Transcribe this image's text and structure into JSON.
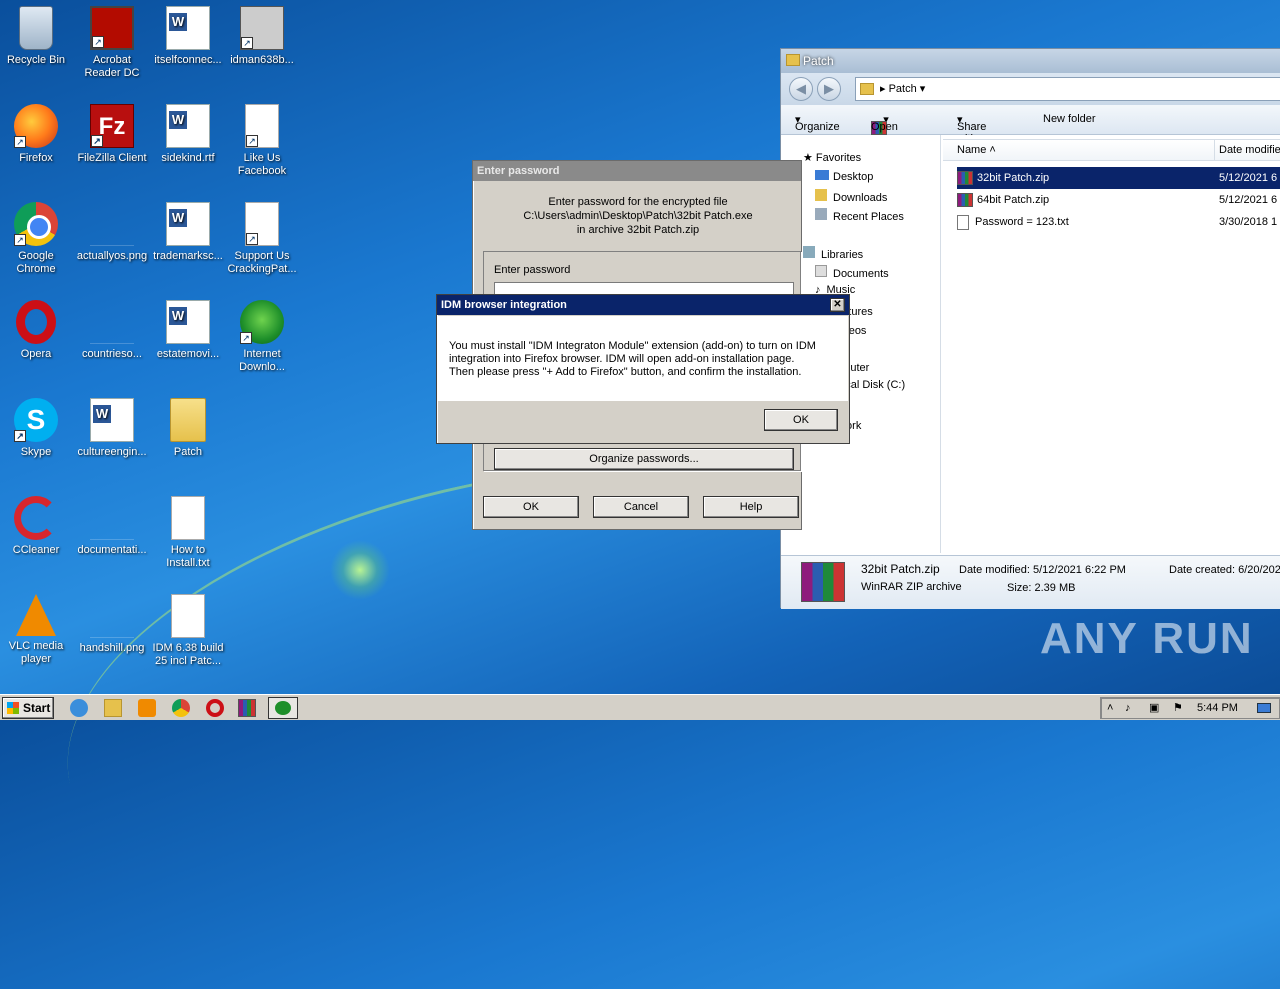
{
  "desktop": {
    "icons": [
      {
        "label": "Recycle Bin"
      },
      {
        "label": "Acrobat Reader DC"
      },
      {
        "label": "itselfconnec..."
      },
      {
        "label": "idman638b..."
      },
      {
        "label": "Firefox"
      },
      {
        "label": "FileZilla Client"
      },
      {
        "label": "sidekind.rtf"
      },
      {
        "label": "Like Us Facebook"
      },
      {
        "label": "Google Chrome"
      },
      {
        "label": "actuallyos.png"
      },
      {
        "label": "trademarksc..."
      },
      {
        "label": "Support Us CrackingPat..."
      },
      {
        "label": "Opera"
      },
      {
        "label": "countrieso..."
      },
      {
        "label": "estatemovi..."
      },
      {
        "label": "Internet Downlo..."
      },
      {
        "label": "Skype"
      },
      {
        "label": "cultureengin..."
      },
      {
        "label": "Patch"
      },
      {
        "label": "CCleaner"
      },
      {
        "label": "documentati..."
      },
      {
        "label": "How to Install.txt"
      },
      {
        "label": "VLC media player"
      },
      {
        "label": "handshill.png"
      },
      {
        "label": "IDM 6.38 build 25 incl Patc..."
      }
    ]
  },
  "explorer": {
    "title": "Patch",
    "address": "Patch",
    "toolbar": {
      "organize": "Organize",
      "open": "Open",
      "share": "Share with",
      "new_folder": "New folder"
    },
    "nav": {
      "favorites": "Favorites",
      "desktop": "Desktop",
      "downloads": "Downloads",
      "recent": "Recent Places",
      "libraries": "Libraries",
      "documents": "Documents",
      "music": "Music",
      "pictures": "Pictures",
      "videos": "Videos",
      "computer": "Computer",
      "local_disk": "Local Disk (C:)",
      "network": "Network"
    },
    "columns": {
      "name": "Name",
      "date": "Date modifie"
    },
    "files": [
      {
        "name": "32bit Patch.zip",
        "date": "5/12/2021 6"
      },
      {
        "name": "64bit Patch.zip",
        "date": "5/12/2021 6"
      },
      {
        "name": "Password = 123.txt",
        "date": "3/30/2018 1"
      }
    ],
    "details": {
      "name": "32bit Patch.zip",
      "type": "WinRAR ZIP archive",
      "modified": "Date modified: 5/12/2021 6:22 PM",
      "size": "Size: 2.39 MB",
      "created": "Date created: 6/20/202"
    }
  },
  "password_dialog": {
    "title": "Enter password",
    "line1": "Enter password for the encrypted file",
    "line2": "C:\\Users\\admin\\Desktop\\Patch\\32bit Patch.exe",
    "line3": "in archive 32bit Patch.zip",
    "field_label": "Enter password",
    "organize": "Organize passwords...",
    "ok": "OK",
    "cancel": "Cancel",
    "help": "Help"
  },
  "idm_dialog": {
    "title": "IDM browser integration",
    "line1": "You must install \"IDM Integraton Module\" extension (add-on) to turn on IDM",
    "line2": "integration into Firefox browser. IDM will open add-on installation page.",
    "line3": "Then please press \"+ Add to Firefox\" button, and confirm the installation.",
    "ok": "OK"
  },
  "watermark": "ANY RUN",
  "taskbar": {
    "start": "Start",
    "clock": "5:44 PM"
  }
}
